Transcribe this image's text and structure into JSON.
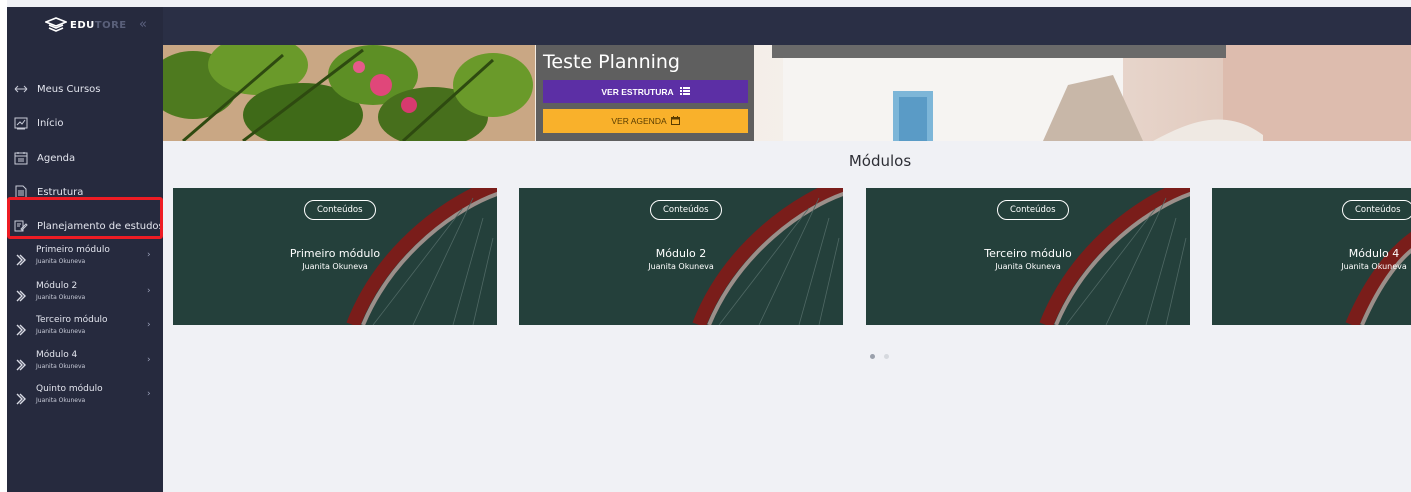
{
  "sidebar": {
    "logo": {
      "text_bold": "EDU",
      "text_dim": "TORE"
    },
    "nav": [
      {
        "label": "Meus Cursos",
        "icon": "arrows-horizontal-icon"
      },
      {
        "label": "Início",
        "icon": "chart-icon"
      },
      {
        "label": "Agenda",
        "icon": "calendar-icon"
      },
      {
        "label": "Estrutura",
        "icon": "document-icon"
      },
      {
        "label": "Planejamento de estudos",
        "icon": "edit-document-icon"
      }
    ],
    "modules": [
      {
        "title": "Primeiro módulo",
        "author": "Juanita Okuneva"
      },
      {
        "title": "Módulo 2",
        "author": "Juanita Okuneva"
      },
      {
        "title": "Terceiro módulo",
        "author": "Juanita Okuneva"
      },
      {
        "title": "Módulo 4",
        "author": "Juanita Okuneva"
      },
      {
        "title": "Quinto módulo",
        "author": "Juanita Okuneva"
      }
    ]
  },
  "banner": {
    "course_title": "Teste Planning",
    "btn_estrutura": "VER ESTRUTURA",
    "btn_agenda": "VER AGENDA"
  },
  "main": {
    "section_title": "Módulos",
    "cards": [
      {
        "pill": "Conteúdos",
        "title": "Primeiro módulo",
        "author": "Juanita Okuneva"
      },
      {
        "pill": "Conteúdos",
        "title": "Módulo 2",
        "author": "Juanita Okuneva"
      },
      {
        "pill": "Conteúdos",
        "title": "Terceiro módulo",
        "author": "Juanita Okuneva"
      },
      {
        "pill": "Conteúdos",
        "title": "Módulo 4",
        "author": "Juanita Okuneva"
      }
    ],
    "carousel": {
      "pages": 2,
      "active": 1
    }
  },
  "colors": {
    "sidebar_bg": "#262a3e",
    "topbar_bg": "#2a2f45",
    "purple": "#5c2fa5",
    "yellow": "#f9b12b",
    "card_bg": "#24403b",
    "highlight": "#ee1c24"
  }
}
